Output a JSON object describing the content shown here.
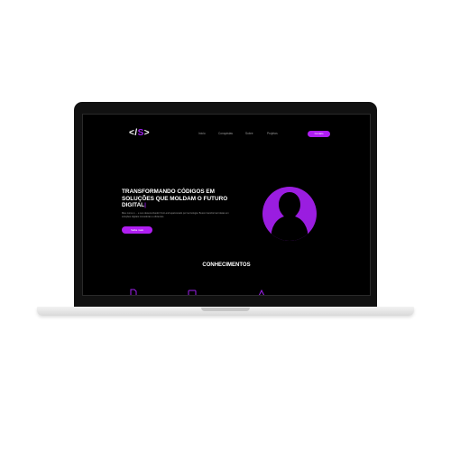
{
  "site": {
    "logo": {
      "prefix": "</",
      "letter": "S",
      "suffix": ">"
    },
    "nav": [
      "Início",
      "Conquistas",
      "Sobre",
      "Projetos"
    ],
    "cta_label": "Contato",
    "hero": {
      "title": "TRANSFORMANDO CÓDIGOS EM SOLUÇÕES QUE MOLDAM O FUTURO DIGITAL",
      "cursor": "|",
      "subtitle": "Meu nome é ... e sou desenvolvedor front-end apaixonado por tecnologia. Busco transformar ideias em soluções digitais inovadoras e eficientes.",
      "button_label": "Saiba mais"
    },
    "section_title": "CONHECIMENTOS",
    "skill_icons": [
      "file-icon",
      "window-icon",
      "bug-icon"
    ]
  },
  "colors": {
    "accent": "#b01ef2",
    "background": "#000000",
    "laptop_bezel": "#111111",
    "laptop_base": "#e6e6e6"
  }
}
